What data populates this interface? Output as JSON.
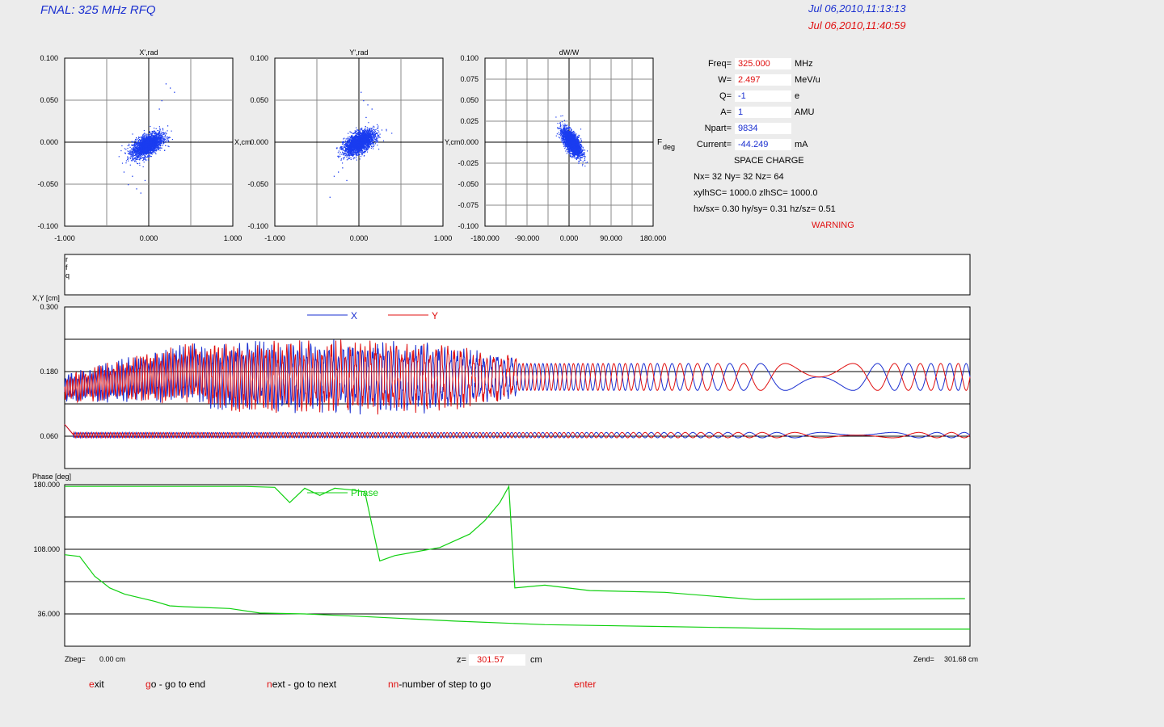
{
  "window": {
    "title": "FNAL: 325 MHz RFQ",
    "date_start": "Jul 06,2010,11:13:13",
    "date_current": "Jul 06,2010,11:40:59"
  },
  "params": [
    {
      "label": "Freq=",
      "value": "325.000",
      "unit": "MHz",
      "value_color": "red"
    },
    {
      "label": "W=",
      "value": "2.497",
      "unit": "MeV/u",
      "value_color": "red"
    },
    {
      "label": "Q=",
      "value": "-1",
      "unit": "e",
      "value_color": "blue"
    },
    {
      "label": "A=",
      "value": "1",
      "unit": "AMU",
      "value_color": "blue"
    },
    {
      "label": "Npart=",
      "value": "9834",
      "unit": "",
      "value_color": "blue"
    },
    {
      "label": "Current=",
      "value": "-44.249",
      "unit": "mA",
      "value_color": "blue"
    }
  ],
  "space_charge": {
    "heading": "SPACE CHARGE",
    "line1": "Nx= 32   Ny= 32   Nz= 64",
    "line2": "xylhSC= 1000.0   zlhSC=   1000.0",
    "line3": "hx/sx=  0.30  hy/sy=  0.31  hz/sz=  0.51",
    "warning": "WARNING"
  },
  "rfq_box_labels": [
    "r",
    "f",
    "q"
  ],
  "zbar": {
    "zbeg_label": "Zbeg=",
    "zbeg_value": "0.00 cm",
    "z_label": "z=",
    "z_value": "301.57",
    "z_unit": "cm",
    "zend_label": "Zend=",
    "zend_value": "301.68 cm"
  },
  "commands": [
    {
      "key": "e",
      "rest": "xit"
    },
    {
      "key": "g",
      "rest": "o - go to end"
    },
    {
      "key": "n",
      "rest": "ext - go to next"
    },
    {
      "key": "nn",
      "rest": "-number of step to go"
    },
    {
      "key": "enter",
      "rest": ""
    }
  ],
  "colors": {
    "x_series": "#1a2fd0",
    "y_series": "#e01010",
    "phase_series": "#10d010",
    "scatter": "#1a3cf0"
  },
  "chart_data": [
    {
      "type": "scatter",
      "title": "X',rad",
      "xlabel": "X,cm",
      "xlim": [
        -1.0,
        1.0
      ],
      "ylim": [
        -0.1,
        0.1
      ],
      "x_ticks": [
        "-1.000",
        "0.000",
        "1.000"
      ],
      "y_ticks": [
        "0.100",
        "0.050",
        "0.000",
        "-0.050",
        "-0.100"
      ],
      "core": {
        "cx": -0.02,
        "cy": -0.003,
        "sx": 0.09,
        "sy": 0.007,
        "rho": 0.55,
        "n": 2500
      },
      "outliers": [
        [
          0.2,
          0.07
        ],
        [
          0.25,
          0.065
        ],
        [
          0.3,
          0.06
        ],
        [
          -0.3,
          -0.035
        ],
        [
          -0.25,
          -0.05
        ],
        [
          -0.15,
          -0.055
        ],
        [
          -0.1,
          -0.06
        ],
        [
          -0.2,
          -0.04
        ],
        [
          0.12,
          0.04
        ],
        [
          0.15,
          0.05
        ],
        [
          -0.05,
          -0.045
        ],
        [
          0.22,
          0.02
        ]
      ]
    },
    {
      "type": "scatter",
      "title": "Y',rad",
      "xlabel": "Y,cm",
      "xlim": [
        -1.0,
        1.0
      ],
      "ylim": [
        -0.1,
        0.1
      ],
      "x_ticks": [
        "-1.000",
        "0.000",
        "1.000"
      ],
      "y_ticks": [
        "0.100",
        "0.050",
        "0.000",
        "-0.050",
        "-0.100"
      ],
      "core": {
        "cx": 0.0,
        "cy": 0.0,
        "sx": 0.09,
        "sy": 0.007,
        "rho": 0.55,
        "n": 2500
      },
      "outliers": [
        [
          0.05,
          0.05
        ],
        [
          0.1,
          0.045
        ],
        [
          0.15,
          0.04
        ],
        [
          -0.3,
          -0.04
        ],
        [
          -0.25,
          -0.035
        ],
        [
          -0.2,
          -0.03
        ],
        [
          -0.35,
          -0.065
        ],
        [
          -0.1,
          -0.02
        ],
        [
          0.02,
          0.06
        ],
        [
          -0.15,
          -0.045
        ],
        [
          0.08,
          0.03
        ]
      ]
    },
    {
      "type": "scatter",
      "title": "dW/W",
      "xlabel": "F,deg",
      "xlim": [
        -180,
        180
      ],
      "ylim": [
        -0.1,
        0.1
      ],
      "x_ticks": [
        "-180.000",
        "-90.000",
        "0.000",
        "90.000",
        "180.000"
      ],
      "y_ticks": [
        "0.100",
        "0.075",
        "0.050",
        "0.025",
        "0.000",
        "-0.025",
        "-0.050",
        "-0.075",
        "-0.100"
      ],
      "core": {
        "cx": 5,
        "cy": 0.0,
        "sx": 10,
        "sy": 0.008,
        "rho": -0.65,
        "n": 2500
      },
      "outliers": [
        [
          -10,
          0.022
        ],
        [
          -12,
          0.02
        ],
        [
          15,
          -0.02
        ],
        [
          20,
          -0.022
        ],
        [
          25,
          -0.012
        ]
      ]
    },
    {
      "type": "line",
      "ylabel": "X,Y [cm]",
      "ylim": [
        0.0,
        0.3
      ],
      "y_ticks": [
        "0.300",
        "0.180",
        "0.060"
      ],
      "y_tick_values": [
        0.3,
        0.18,
        0.06
      ],
      "zlim": [
        0.0,
        301.68
      ],
      "series": [
        {
          "name": "X",
          "envelope": "max",
          "mean": 0.16,
          "amp_start": 0.02,
          "amp_peak": 0.05,
          "amp_end": 0.025
        },
        {
          "name": "Y",
          "envelope": "max",
          "mean": 0.16,
          "amp_start": 0.02,
          "amp_peak": 0.05,
          "amp_end": 0.025
        }
      ],
      "rms_band": {
        "mean": 0.062,
        "amp": 0.005
      }
    },
    {
      "type": "line",
      "ylabel": "Phase [deg]",
      "ylim": [
        0.0,
        180.0
      ],
      "y_ticks": [
        "180.000",
        "108.000",
        "36.000"
      ],
      "y_tick_values": [
        180,
        108,
        36
      ],
      "zlim": [
        0.0,
        301.68
      ],
      "series": [
        {
          "name": "Phase",
          "points": [
            [
              0,
              178
            ],
            [
              60,
              178
            ],
            [
              70,
              177
            ],
            [
              75,
              160
            ],
            [
              80,
              176
            ],
            [
              85,
              168
            ],
            [
              90,
              176
            ],
            [
              96,
              174
            ],
            [
              100,
              172
            ],
            [
              105,
              95
            ],
            [
              110,
              101
            ],
            [
              125,
              110
            ],
            [
              135,
              125
            ],
            [
              140,
              140
            ],
            [
              145,
              160
            ],
            [
              148,
              178
            ],
            [
              150,
              65
            ],
            [
              160,
              68
            ],
            [
              175,
              62
            ],
            [
              200,
              60
            ],
            [
              230,
              52
            ],
            [
              300,
              53
            ]
          ]
        },
        {
          "name": "",
          "points": [
            [
              0,
              102
            ],
            [
              5,
              100
            ],
            [
              10,
              78
            ],
            [
              15,
              65
            ],
            [
              20,
              58
            ],
            [
              30,
              50
            ],
            [
              35,
              45
            ],
            [
              40,
              44
            ],
            [
              55,
              42
            ],
            [
              65,
              37
            ],
            [
              80,
              36
            ],
            [
              100,
              33
            ],
            [
              130,
              28
            ],
            [
              160,
              24
            ],
            [
              200,
              22
            ],
            [
              250,
              19
            ],
            [
              301.68,
              19
            ]
          ]
        }
      ]
    }
  ]
}
